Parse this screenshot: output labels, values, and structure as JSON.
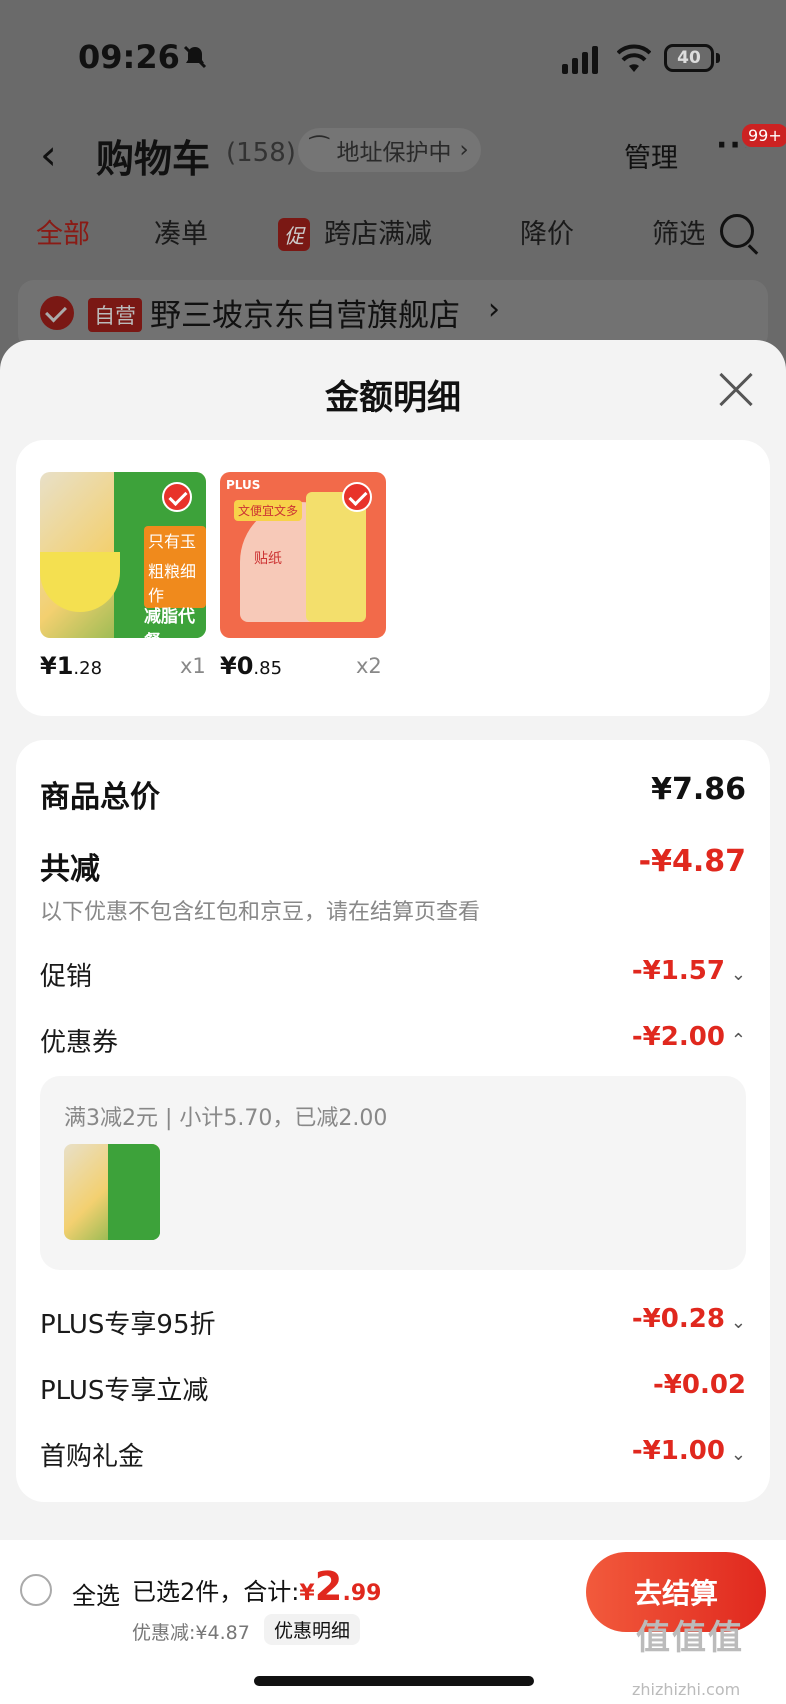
{
  "status_bar": {
    "time": "09:26",
    "battery": "40"
  },
  "header": {
    "title": "购物车",
    "count": "(158)",
    "address_protect": "地址保护中",
    "manage": "管理",
    "more": "···",
    "badge": "99+"
  },
  "tabs": [
    {
      "label": "全部"
    },
    {
      "label": "凑单"
    },
    {
      "label": "跨店满减",
      "promo_tag": "促"
    },
    {
      "label": "降价"
    },
    {
      "label": "筛选"
    }
  ],
  "store": {
    "tag": "自营",
    "name": "野三坡京东自营旗舰店"
  },
  "sheet": {
    "title": "金额明细"
  },
  "products": [
    {
      "price_int": "¥1",
      "price_dec": ".28",
      "qty": "x1",
      "img_texts": [
        "只有玉米",
        "粗粮细作",
        "减脂代餐"
      ]
    },
    {
      "price_int": "¥0",
      "price_dec": ".85",
      "qty": "x2",
      "img_texts": [
        "PLUS",
        "文便宜文多",
        "贴纸"
      ]
    }
  ],
  "summary": {
    "total_label": "商品总价",
    "total_value": "¥7.86",
    "discount_label": "共减",
    "discount_value": "-¥4.87",
    "note": "以下优惠不包含红包和京豆，请在结算页查看",
    "items": [
      {
        "label": "促销",
        "value": "-¥1.57",
        "chevron": "down"
      },
      {
        "label": "优惠券",
        "value": "-¥2.00",
        "chevron": "up"
      }
    ],
    "coupon_detail": "满3减2元 | 小计5.70，已减2.00",
    "items2": [
      {
        "label": "PLUS专享95折",
        "value": "-¥0.28",
        "chevron": "down"
      },
      {
        "label": "PLUS专享立减",
        "value": "-¥0.02",
        "chevron": ""
      },
      {
        "label": "首购礼金",
        "value": "-¥1.00",
        "chevron": "down"
      }
    ]
  },
  "bottom": {
    "select_all": "全选",
    "selected_text": "已选2件，合计:",
    "yen": "¥",
    "amount_int": "2",
    "amount_dec": ".99",
    "discount_text": "优惠减:¥4.87",
    "detail_button": "优惠明细",
    "checkout": "去结算",
    "watermark": "值值值",
    "watermark_url": "zhizhizhi.com"
  },
  "colors": {
    "accent": "#e0281e",
    "overlay": "#6a6a6a",
    "sheet_bg": "#f3f3f3"
  }
}
